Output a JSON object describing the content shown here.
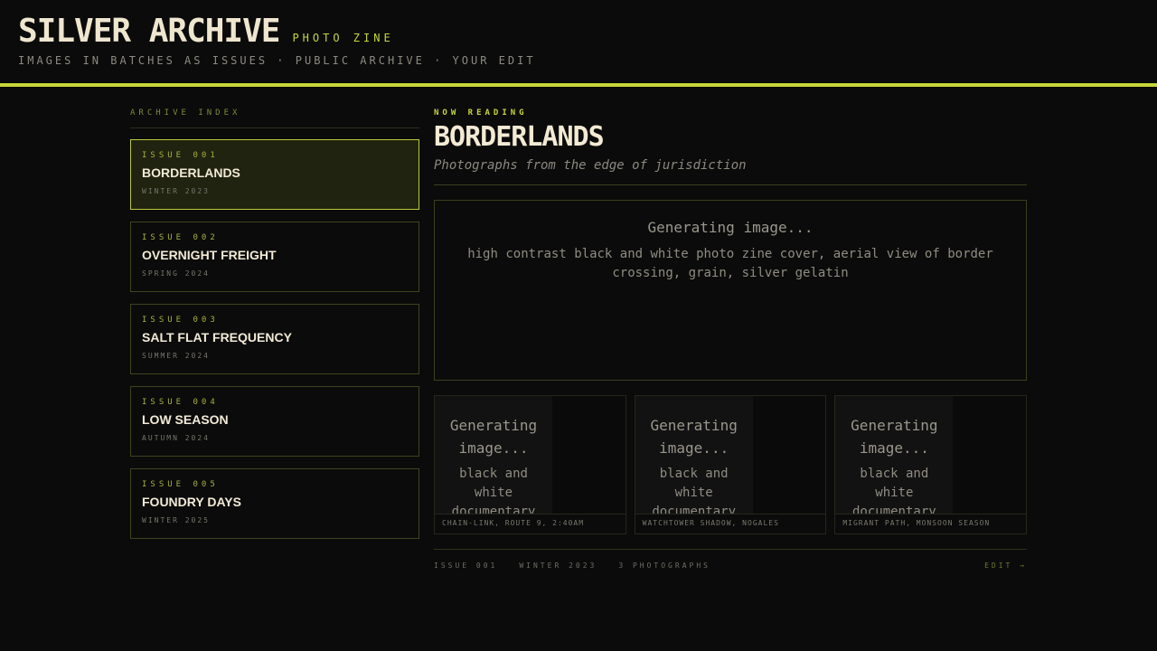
{
  "header": {
    "title": "SILVER ARCHIVE",
    "tag": "PHOTO ZINE",
    "subtitle": "IMAGES IN BATCHES AS ISSUES · PUBLIC ARCHIVE · YOUR EDIT"
  },
  "index": {
    "heading": "ARCHIVE INDEX",
    "issues": [
      {
        "number": "ISSUE 001",
        "title": "BORDERLANDS",
        "season": "WINTER 2023",
        "active": true
      },
      {
        "number": "ISSUE 002",
        "title": "OVERNIGHT FREIGHT",
        "season": "SPRING 2024"
      },
      {
        "number": "ISSUE 003",
        "title": "SALT FLAT FREQUENCY",
        "season": "SUMMER 2024"
      },
      {
        "number": "ISSUE 004",
        "title": "LOW SEASON",
        "season": "AUTUMN 2024"
      },
      {
        "number": "ISSUE 005",
        "title": "FOUNDRY DAYS",
        "season": "WINTER 2025"
      }
    ]
  },
  "reader": {
    "label": "NOW READING",
    "title": "BORDERLANDS",
    "subtitle": "Photographs from the edge of jurisdiction",
    "cover": {
      "status": "Generating image...",
      "prompt": "high contrast black and white photo zine cover, aerial view of border crossing, grain, silver gelatin"
    },
    "photos": [
      {
        "status": "Generating image...",
        "prompt": "black and white documentary",
        "caption": "CHAIN-LINK, ROUTE 9, 2:40AM"
      },
      {
        "status": "Generating image...",
        "prompt": "black and white documentary",
        "caption": "WATCHTOWER SHADOW, NOGALES"
      },
      {
        "status": "Generating image...",
        "prompt": "black and white documentary",
        "caption": "MIGRANT PATH, MONSOON SEASON"
      }
    ],
    "footer": {
      "issue": "ISSUE 001",
      "season": "WINTER 2023",
      "count": "3 PHOTOGRAPHS",
      "edit": "EDIT →"
    }
  },
  "colors": {
    "accent": "#c6d63a",
    "background": "#0b0b0b",
    "text": "#efe6cf"
  }
}
